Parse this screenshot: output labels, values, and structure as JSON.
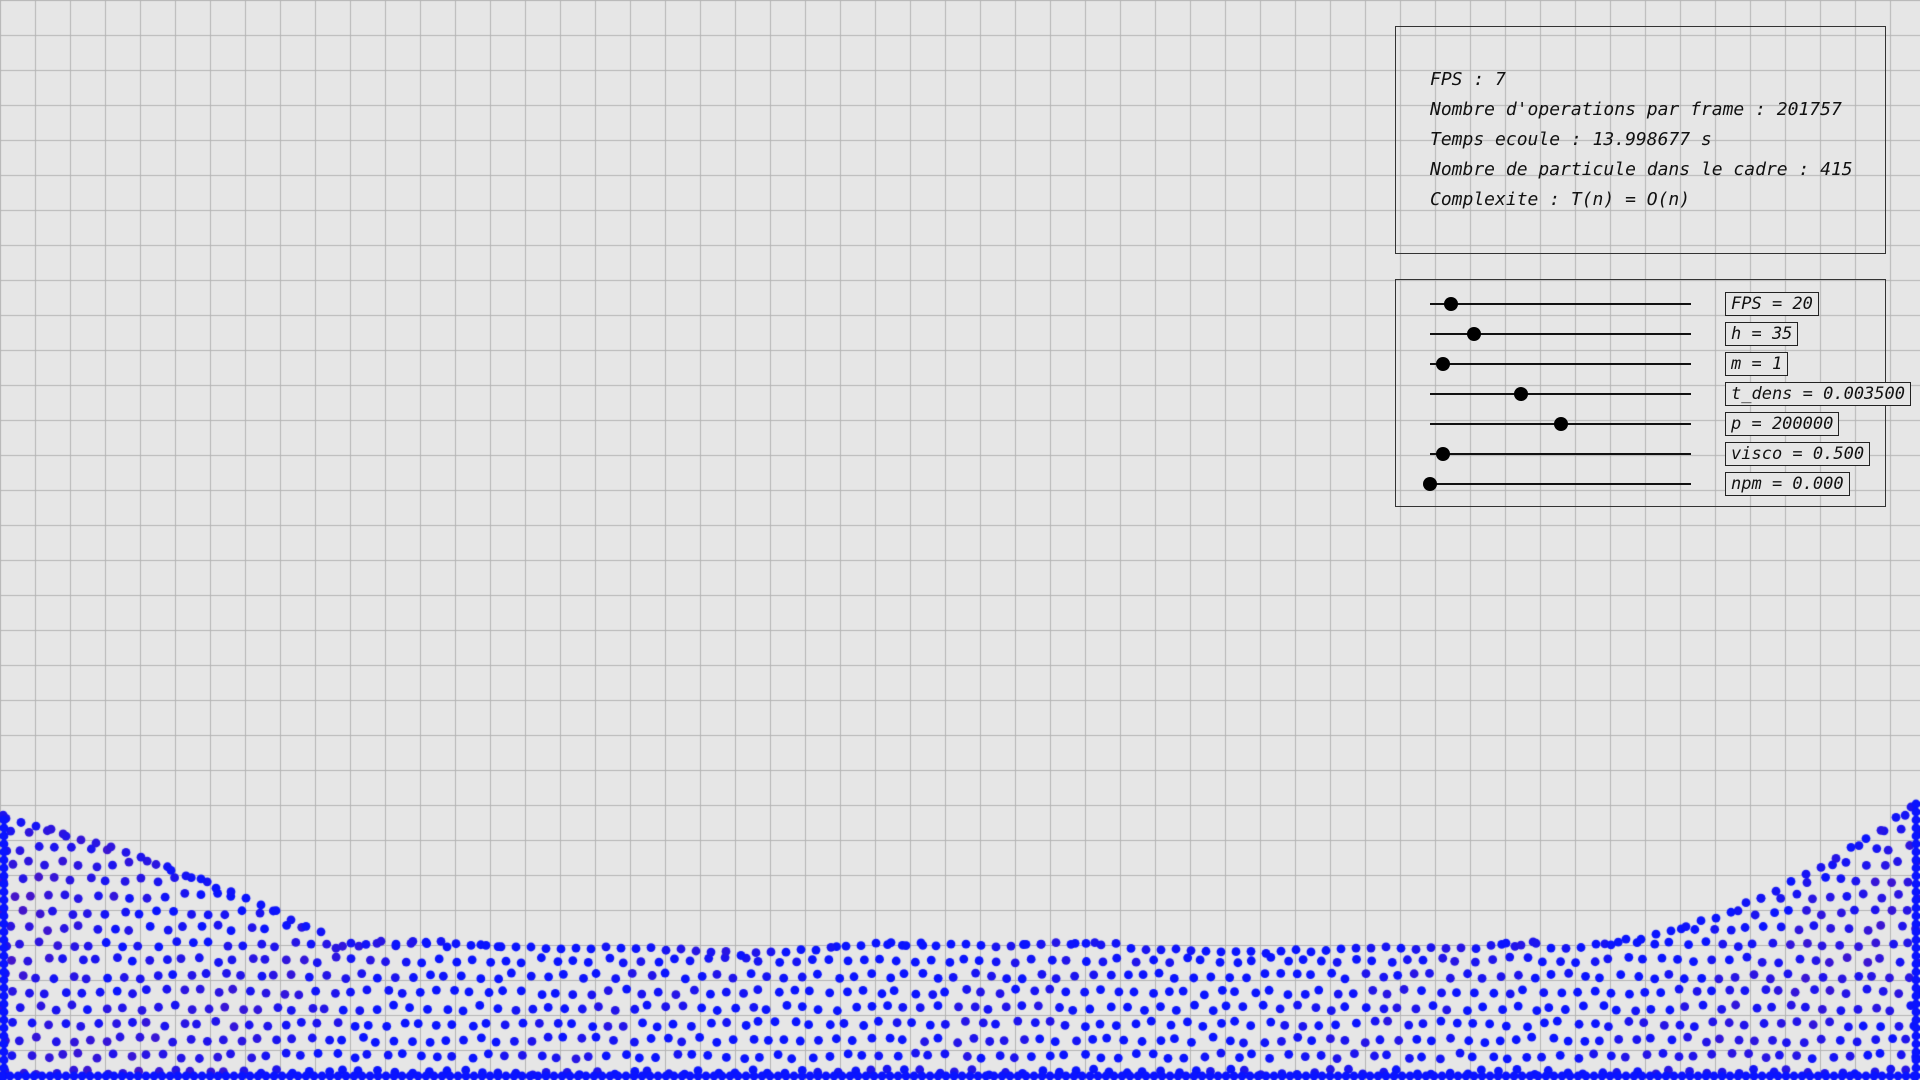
{
  "colors": {
    "background": "#e6e6e6",
    "grid": "#b4b4b4",
    "particle_low": "#0a14ff",
    "particle_high": "#6a16a8",
    "text": "#111111"
  },
  "stats": {
    "fps": "FPS : 7",
    "ops": "Nombre d'operations par frame : 201757",
    "time": "Temps ecoule : 13.998677 s",
    "count": "Nombre de particule dans le cadre : 415",
    "complexity": "Complexite : T(n) = O(n)"
  },
  "sliders": [
    {
      "name": "fps",
      "label": "FPS = 20",
      "level": 0.08
    },
    {
      "name": "h",
      "label": "h = 35",
      "level": 0.17
    },
    {
      "name": "m",
      "label": "m = 1",
      "level": 0.05
    },
    {
      "name": "t-dens",
      "label": "t_dens = 0.003500",
      "level": 0.35
    },
    {
      "name": "p",
      "label": "p = 200000",
      "level": 0.5
    },
    {
      "name": "visco",
      "label": "visco = 0.500",
      "level": 0.05
    },
    {
      "name": "npm",
      "label": "npm = 0.000",
      "level": 0.0
    }
  ]
}
